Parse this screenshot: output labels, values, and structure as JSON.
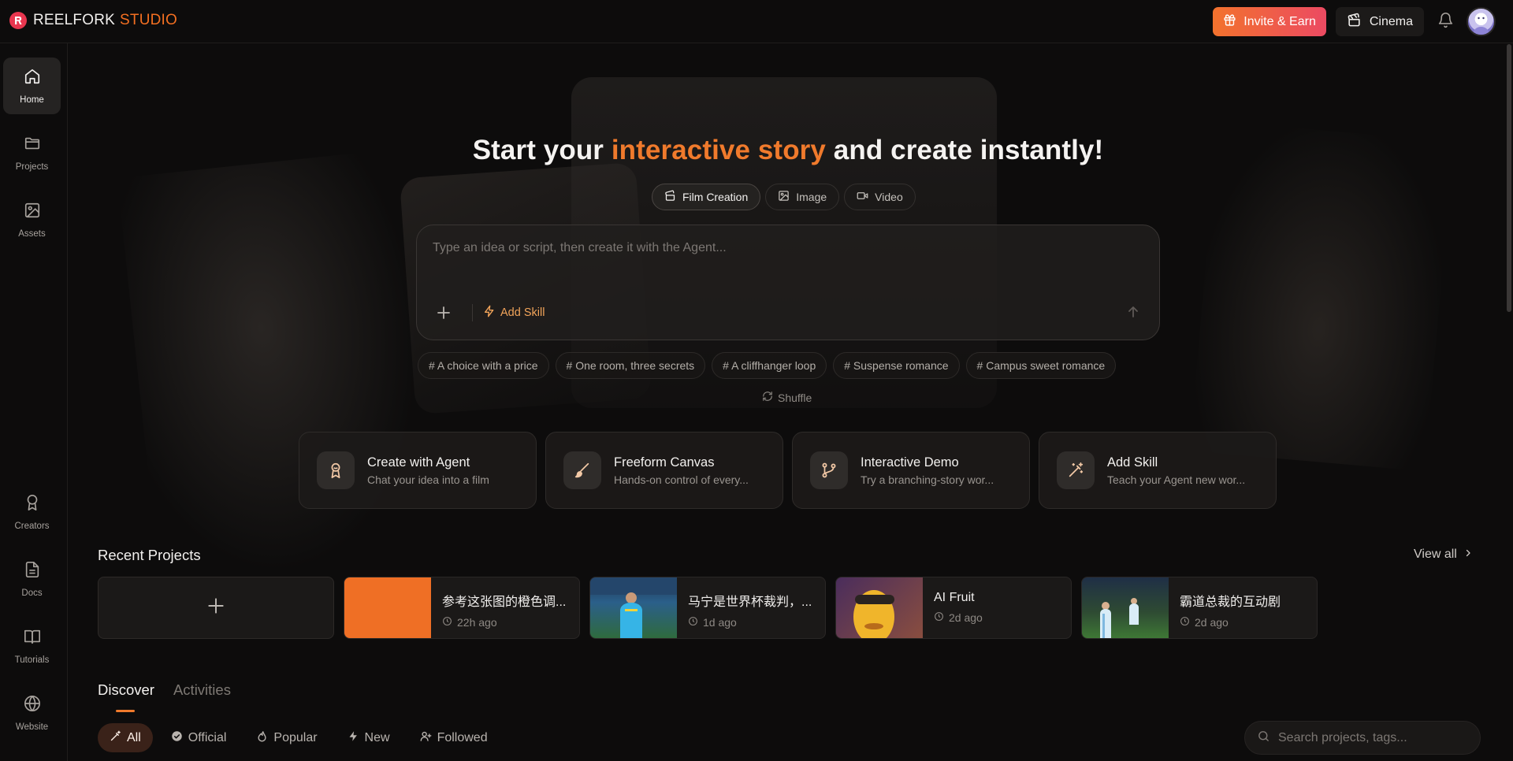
{
  "brand": {
    "name": "REELFORK",
    "accent": "STUDIO",
    "color": "#f36f21"
  },
  "topbar": {
    "invite_label": "Invite & Earn",
    "cinema_label": "Cinema"
  },
  "sidebar": {
    "items": [
      {
        "label": "Home",
        "icon": "home-icon",
        "active": true
      },
      {
        "label": "Projects",
        "icon": "folder-icon"
      },
      {
        "label": "Assets",
        "icon": "image-icon"
      },
      {
        "label": "Creators",
        "icon": "award-icon"
      },
      {
        "label": "Docs",
        "icon": "document-icon"
      },
      {
        "label": "Tutorials",
        "icon": "book-icon"
      },
      {
        "label": "Website",
        "icon": "globe-icon"
      }
    ]
  },
  "hero": {
    "title_start": "Start your ",
    "title_accent": "interactive story",
    "title_end": " and create instantly!",
    "modes": [
      {
        "label": "Film Creation",
        "active": true
      },
      {
        "label": "Image"
      },
      {
        "label": "Video"
      }
    ],
    "prompt_placeholder": "Type an idea or script, then create it with the Agent...",
    "add_skill_label": "Add Skill",
    "suggestions": [
      "# A choice with a price",
      "# One room, three secrets",
      "# A cliffhanger loop",
      "# Suspense romance",
      "# Campus sweet romance"
    ],
    "shuffle_label": "Shuffle"
  },
  "features": [
    {
      "title": "Create with Agent",
      "subtitle": "Chat your idea into a film",
      "icon": "agent-icon"
    },
    {
      "title": "Freeform Canvas",
      "subtitle": "Hands-on control of every...",
      "icon": "brush-icon"
    },
    {
      "title": "Interactive Demo",
      "subtitle": "Try a branching-story wor...",
      "icon": "branch-icon"
    },
    {
      "title": "Add Skill",
      "subtitle": "Teach your Agent new wor...",
      "icon": "magic-wand-icon"
    }
  ],
  "recent": {
    "title": "Recent Projects",
    "view_all": "View all",
    "projects": [
      {
        "name": "参考这张图的橙色调...",
        "time": "22h ago"
      },
      {
        "name": "马宁是世界杯裁判，...",
        "time": "1d ago"
      },
      {
        "name": "AI Fruit",
        "time": "2d ago"
      },
      {
        "name": "霸道总裁的互动剧",
        "time": "2d ago"
      }
    ]
  },
  "discover": {
    "tabs": [
      "Discover",
      "Activities"
    ],
    "filters": [
      "All",
      "Official",
      "Popular",
      "New",
      "Followed"
    ],
    "search_placeholder": "Search projects, tags..."
  }
}
